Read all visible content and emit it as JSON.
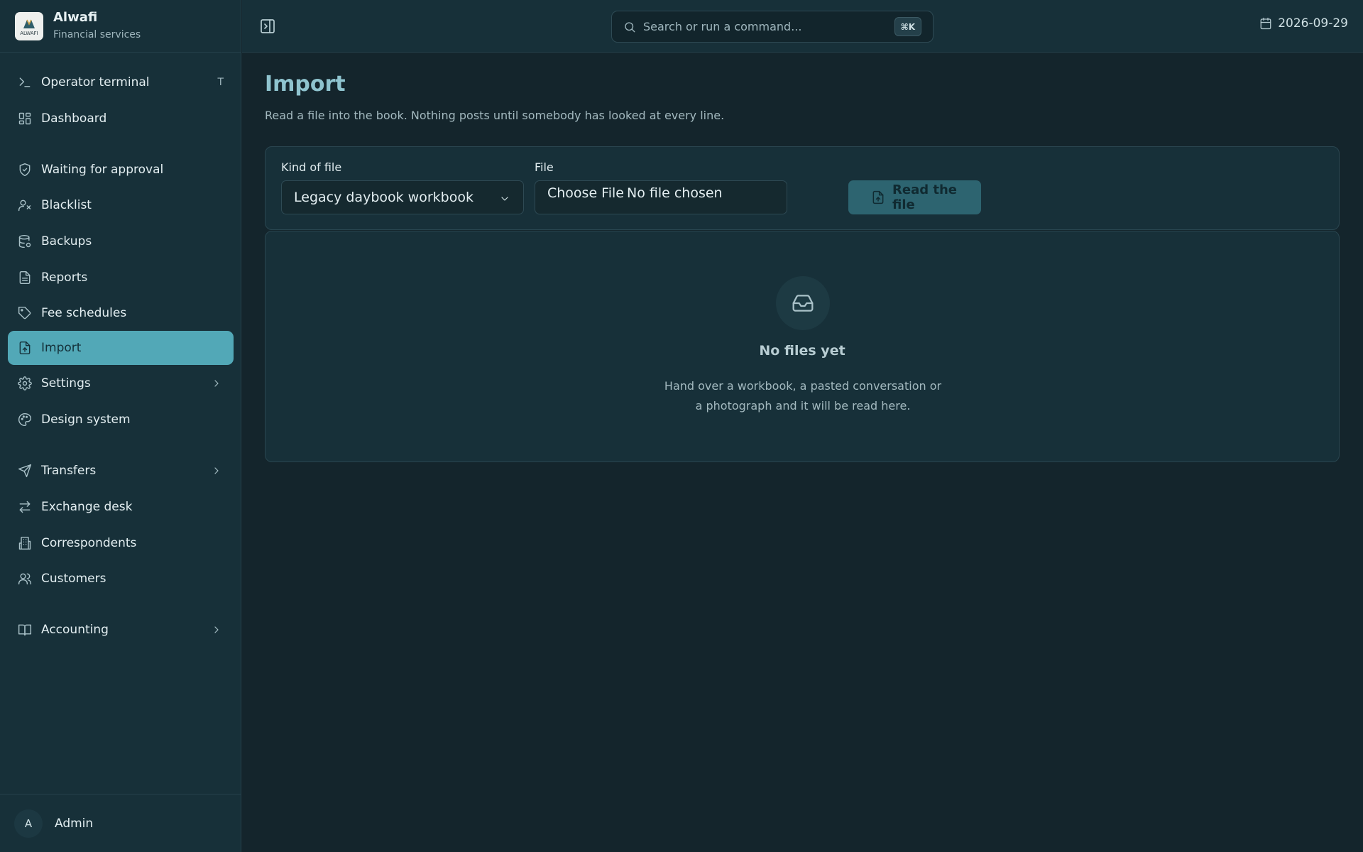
{
  "brand": {
    "name": "Alwafi",
    "subtitle": "Financial services",
    "logo_text": "ALWAFI"
  },
  "sidebar": {
    "items": [
      {
        "label": "Operator terminal",
        "icon": "terminal-icon",
        "shortcut": "T"
      },
      {
        "label": "Dashboard",
        "icon": "dashboard-icon"
      },
      {
        "label": "Waiting for approval",
        "icon": "shield-check-icon"
      },
      {
        "label": "Blacklist",
        "icon": "user-x-icon"
      },
      {
        "label": "Backups",
        "icon": "database-backup-icon"
      },
      {
        "label": "Reports",
        "icon": "file-text-icon"
      },
      {
        "label": "Fee schedules",
        "icon": "tag-icon"
      },
      {
        "label": "Import",
        "icon": "file-upload-icon",
        "active": true
      },
      {
        "label": "Settings",
        "icon": "gear-icon",
        "has_submenu": true
      },
      {
        "label": "Design system",
        "icon": "palette-icon"
      },
      {
        "label": "Transfers",
        "icon": "send-icon",
        "has_submenu": true
      },
      {
        "label": "Exchange desk",
        "icon": "arrows-exchange-icon"
      },
      {
        "label": "Correspondents",
        "icon": "building-icon"
      },
      {
        "label": "Customers",
        "icon": "users-icon"
      },
      {
        "label": "Accounting",
        "icon": "book-icon",
        "has_submenu": true
      }
    ],
    "active_color": "#52a8b7"
  },
  "user": {
    "initial": "A",
    "name": "Admin"
  },
  "topbar": {
    "search_placeholder": "Search or run a command...",
    "search_shortcut": "⌘K",
    "date": "2026-09-29"
  },
  "page": {
    "title": "Import",
    "description": "Read a file into the book. Nothing posts until somebody has looked at every line."
  },
  "form": {
    "kind_label": "Kind of file",
    "kind_value": "Legacy daybook workbook",
    "file_label": "File",
    "file_button": "Choose File",
    "file_status": "No file chosen",
    "submit_label": "Read the file"
  },
  "empty_state": {
    "icon": "inbox-icon",
    "title": "No files yet",
    "text": "Hand over a workbook, a pasted conversation or a photograph and it will be read here."
  },
  "colors": {
    "background": "#14252c",
    "panel": "#173039",
    "accent": "#52a8b7",
    "title": "#8fc4cf",
    "button": "#2d6470"
  }
}
